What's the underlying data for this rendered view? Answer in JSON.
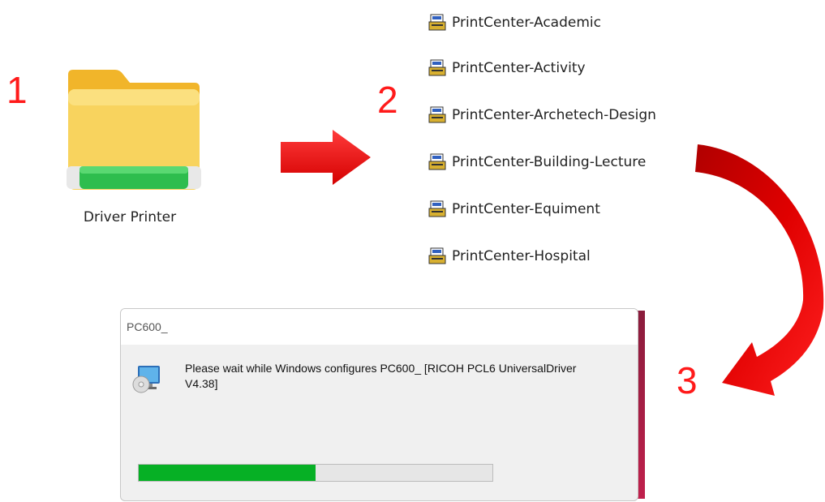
{
  "steps": [
    "1",
    "2",
    "3"
  ],
  "folder": {
    "label": "Driver Printer",
    "icon": "folder-icon"
  },
  "files": [
    {
      "label": "PrintCenter-Academic",
      "icon": "printer-setup-icon"
    },
    {
      "label": "PrintCenter-Activity",
      "icon": "printer-setup-icon"
    },
    {
      "label": "PrintCenter-Archetech-Design",
      "icon": "printer-setup-icon"
    },
    {
      "label": "PrintCenter-Building-Lecture",
      "icon": "printer-setup-icon"
    },
    {
      "label": "PrintCenter-Equiment",
      "icon": "printer-setup-icon"
    },
    {
      "label": "PrintCenter-Hospital",
      "icon": "printer-setup-icon"
    }
  ],
  "dialog": {
    "title": "PC600_",
    "icon": "computer-disc-icon",
    "message": "Please wait while Windows configures PC600_ [RICOH PCL6 UniversalDriver V4.38]",
    "progress_percent": 50
  },
  "colors": {
    "arrow": "#ff1a1a",
    "step_number": "#ff1a1a",
    "progress": "#06b025"
  }
}
